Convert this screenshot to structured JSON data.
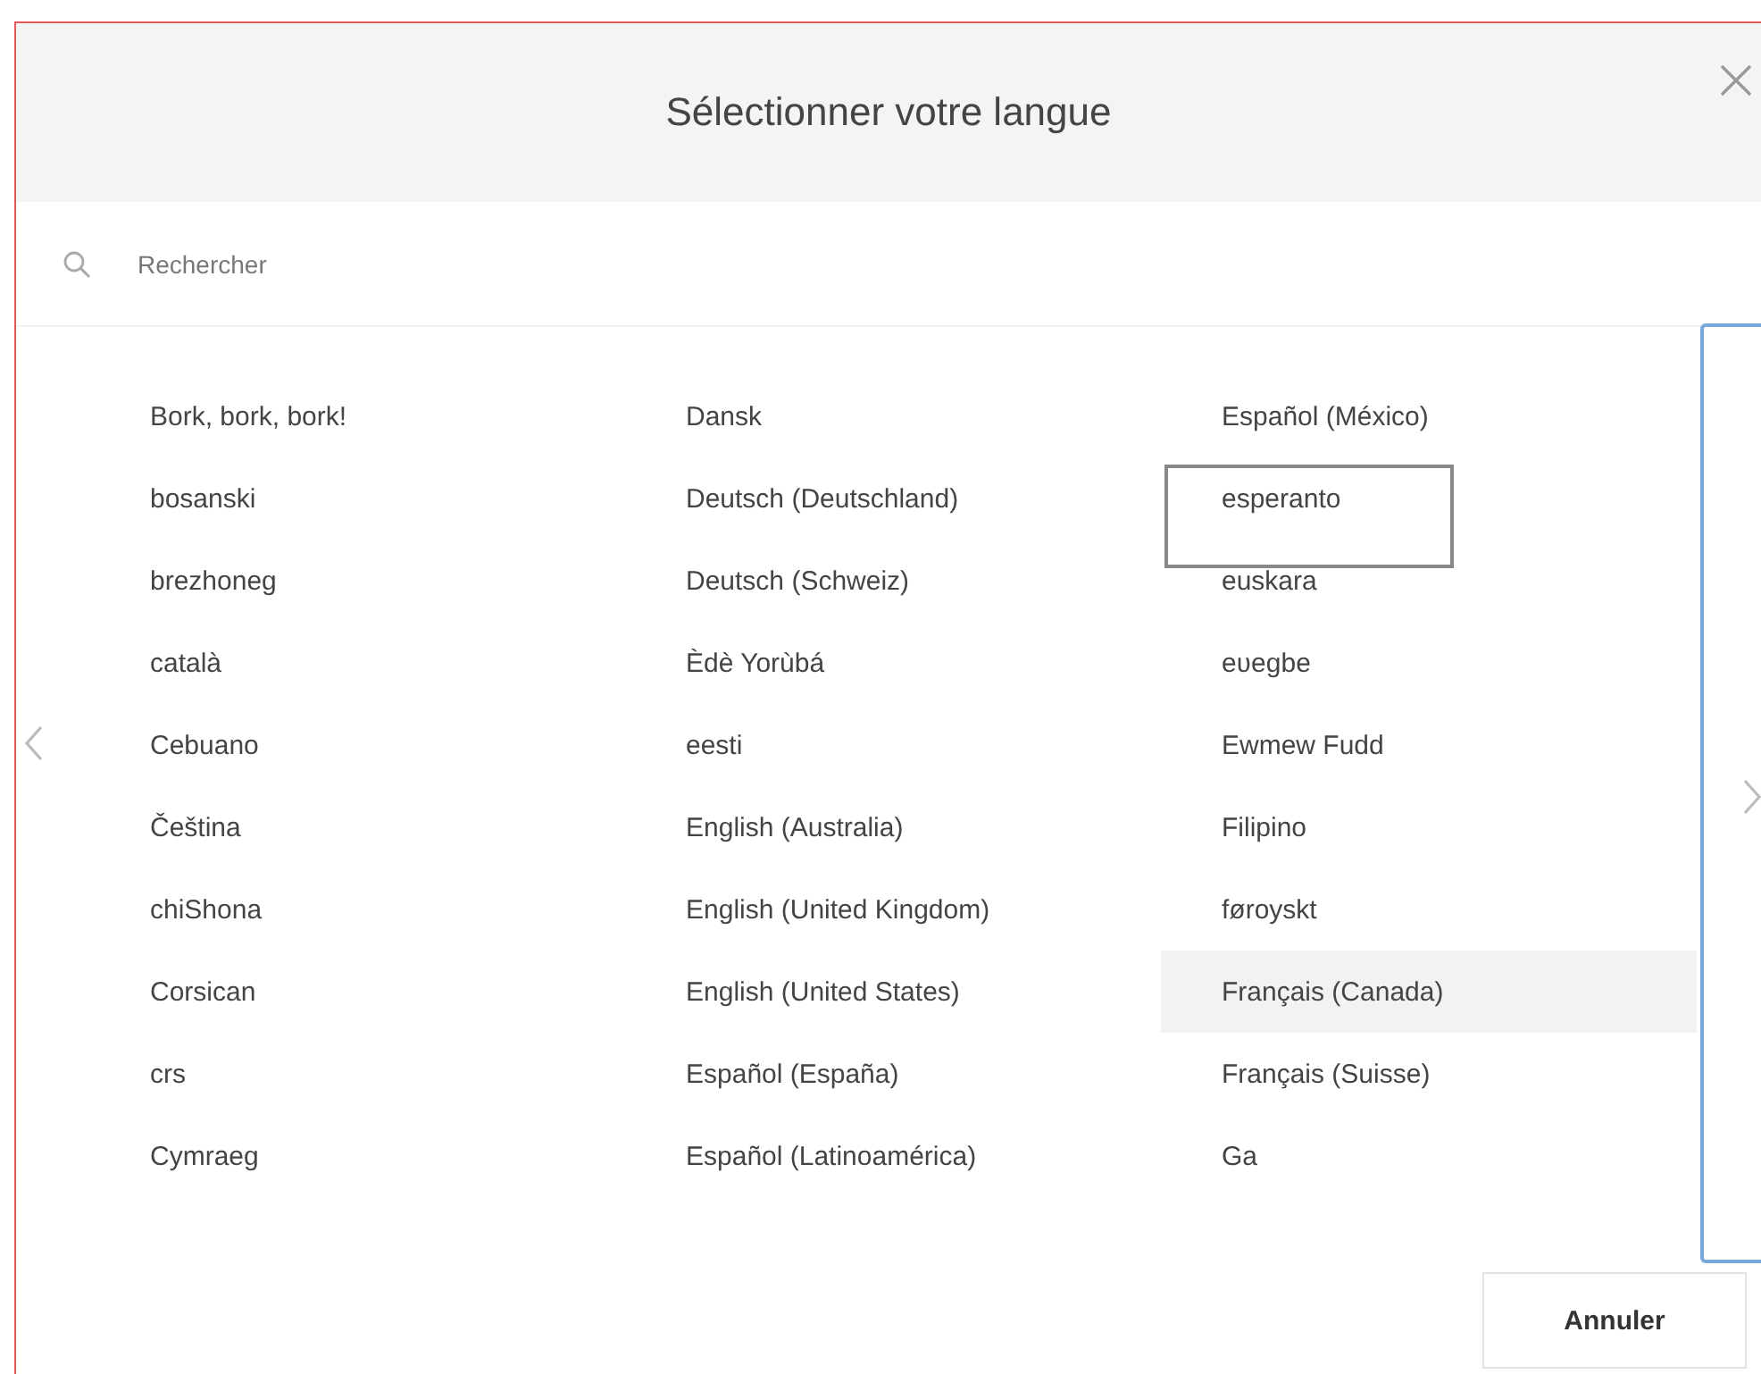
{
  "dialog": {
    "title": "Sélectionner votre langue",
    "search": {
      "placeholder": "Rechercher"
    },
    "columns": [
      {
        "items": [
          {
            "label": "Bork, bork, bork!",
            "selected": false,
            "focused": false
          },
          {
            "label": "bosanski",
            "selected": false,
            "focused": false
          },
          {
            "label": "brezhoneg",
            "selected": false,
            "focused": false
          },
          {
            "label": "català",
            "selected": false,
            "focused": false
          },
          {
            "label": "Cebuano",
            "selected": false,
            "focused": false
          },
          {
            "label": "Čeština",
            "selected": false,
            "focused": false
          },
          {
            "label": "chiShona",
            "selected": false,
            "focused": false
          },
          {
            "label": "Corsican",
            "selected": false,
            "focused": false
          },
          {
            "label": "crs",
            "selected": false,
            "focused": false
          },
          {
            "label": "Cymraeg",
            "selected": false,
            "focused": false
          }
        ]
      },
      {
        "items": [
          {
            "label": "Dansk",
            "selected": false,
            "focused": false
          },
          {
            "label": "Deutsch (Deutschland)",
            "selected": false,
            "focused": false
          },
          {
            "label": "Deutsch (Schweiz)",
            "selected": false,
            "focused": false
          },
          {
            "label": "Èdè Yorùbá",
            "selected": false,
            "focused": false
          },
          {
            "label": "eesti",
            "selected": false,
            "focused": false
          },
          {
            "label": "English (Australia)",
            "selected": false,
            "focused": false
          },
          {
            "label": "English (United Kingdom)",
            "selected": false,
            "focused": false
          },
          {
            "label": "English (United States)",
            "selected": false,
            "focused": false
          },
          {
            "label": "Español (España)",
            "selected": false,
            "focused": false
          },
          {
            "label": "Español (Latinoamérica)",
            "selected": false,
            "focused": false
          }
        ]
      },
      {
        "items": [
          {
            "label": "Español (México)",
            "selected": false,
            "focused": false
          },
          {
            "label": "esperanto",
            "selected": false,
            "focused": true
          },
          {
            "label": "euskara",
            "selected": false,
            "focused": false
          },
          {
            "label": "eʋegbe",
            "selected": false,
            "focused": false
          },
          {
            "label": "Ewmew Fudd",
            "selected": false,
            "focused": false
          },
          {
            "label": "Filipino",
            "selected": false,
            "focused": false
          },
          {
            "label": "føroyskt",
            "selected": false,
            "focused": false
          },
          {
            "label": "Français (Canada)",
            "selected": true,
            "focused": false
          },
          {
            "label": "Français (Suisse)",
            "selected": false,
            "focused": false
          },
          {
            "label": "Ga",
            "selected": false,
            "focused": false
          }
        ]
      }
    ],
    "cancel_button": "Annuler"
  }
}
